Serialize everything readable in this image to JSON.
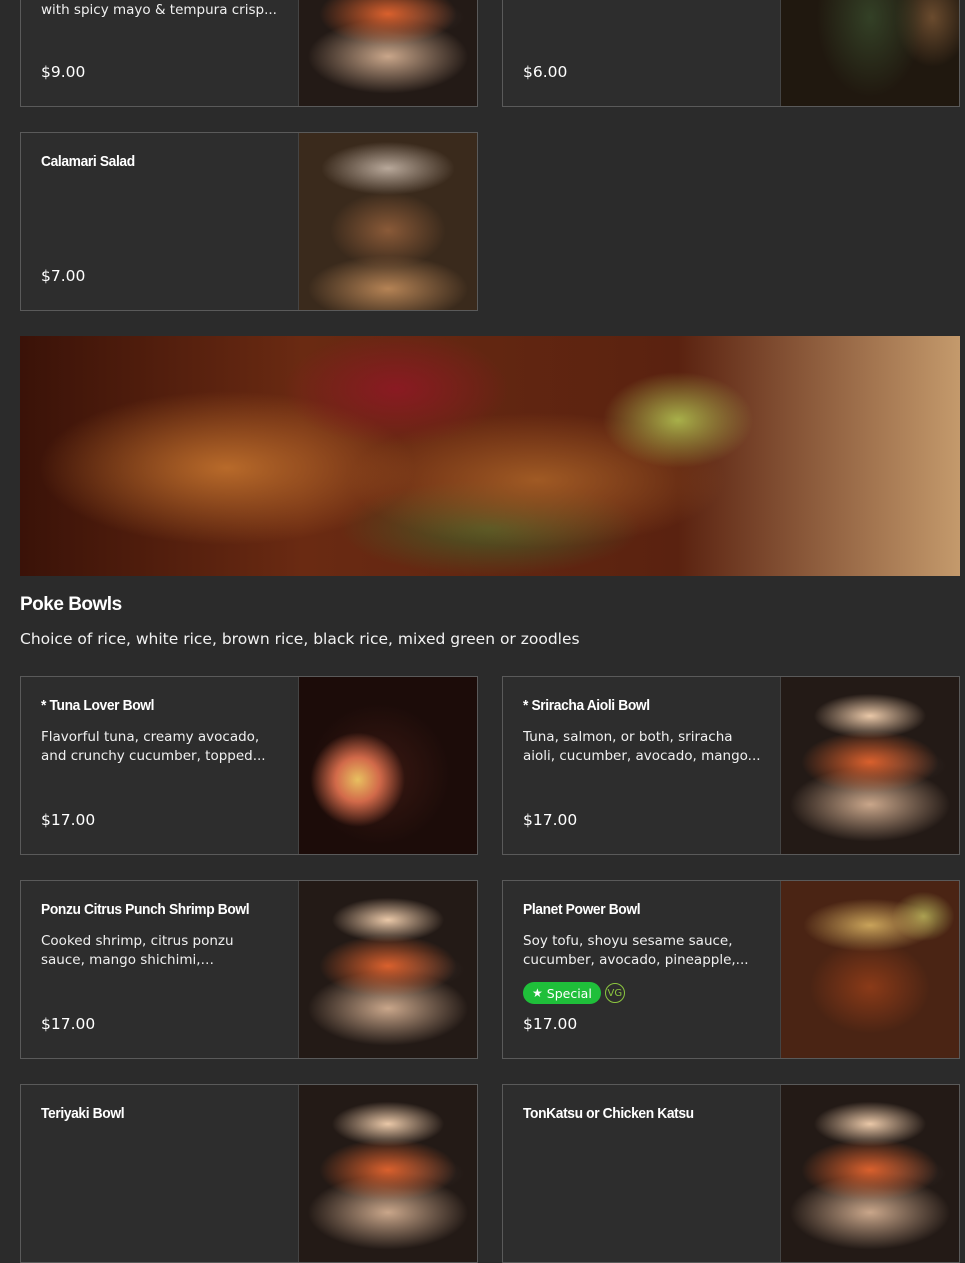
{
  "top_cards": [
    {
      "desc": "with spicy mayo & tempura crisp...",
      "price": "$9.00"
    },
    {
      "desc": "",
      "price": "$6.00"
    }
  ],
  "calamari": {
    "title": "Calamari Salad",
    "price": "$7.00"
  },
  "section": {
    "title": "Poke Bowls",
    "description": "Choice of rice, white rice, brown rice, black rice, mixed green or zoodles"
  },
  "items": [
    {
      "title": "* Tuna Lover Bowl",
      "desc": "Flavorful tuna, creamy avocado, and crunchy cucumber, topped...",
      "price": "$17.00"
    },
    {
      "title": "* Sriracha Aioli Bowl",
      "desc": "Tuna, salmon, or both, sriracha aioli, cucumber, avocado, mango...",
      "price": "$17.00"
    },
    {
      "title": "Ponzu Citrus Punch Shrimp Bowl",
      "desc": "Cooked shrimp, citrus ponzu sauce, mango shichimi, cucumbers,...",
      "price": "$17.00"
    },
    {
      "title": "Planet Power Bowl",
      "desc": "Soy tofu, shoyu sesame sauce, cucumber, avocado, pineapple,...",
      "price": "$17.00",
      "badge_special": "Special",
      "badge_vg": "VG"
    },
    {
      "title": "Teriyaki Bowl"
    },
    {
      "title": "TonKatsu or Chicken Katsu"
    }
  ],
  "icons": {
    "special": "star-icon",
    "vegan": "vg-icon"
  },
  "colors": {
    "background": "#2b2b2b",
    "special_badge": "#1fbf3a",
    "vg_badge": "#8cc63f"
  }
}
